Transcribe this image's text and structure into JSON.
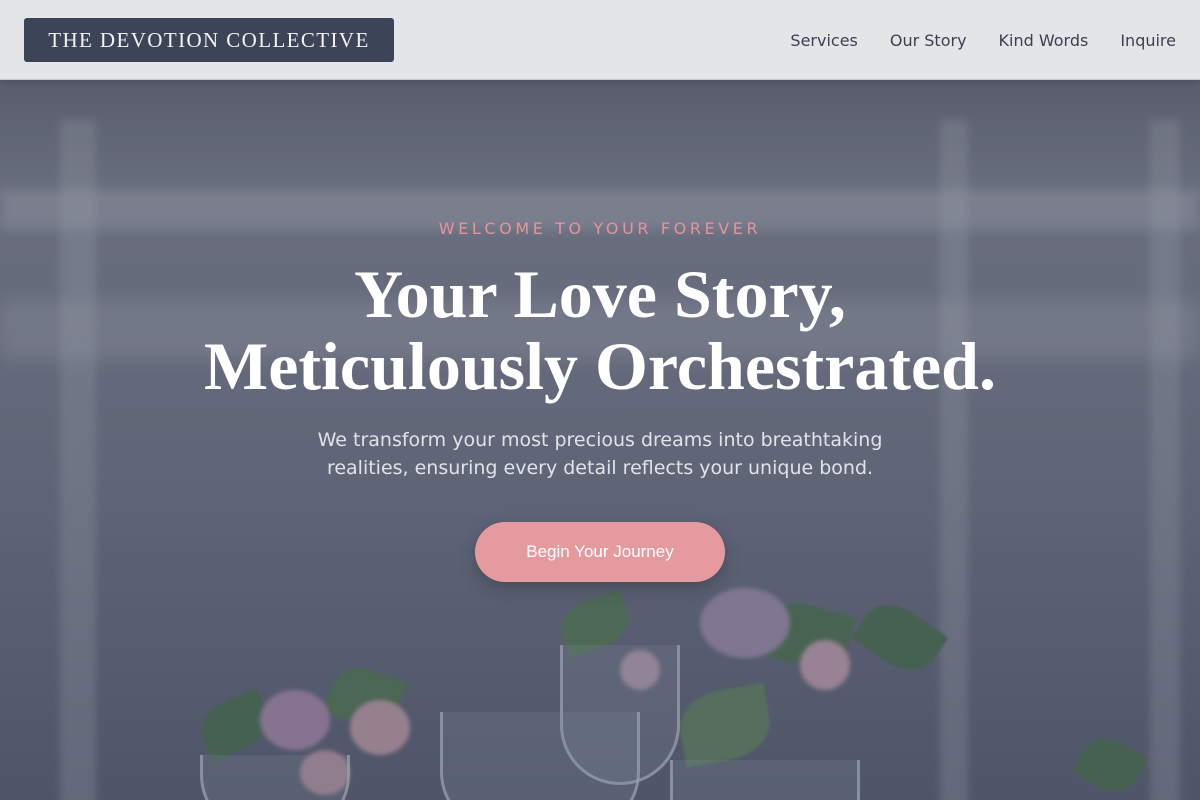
{
  "header": {
    "brand": "THE DEVOTION COLLECTIVE",
    "nav": [
      "Services",
      "Our Story",
      "Kind Words",
      "Inquire"
    ]
  },
  "hero": {
    "eyebrow": "WELCOME TO YOUR FOREVER",
    "headline_line1": "Your Love Story,",
    "headline_line2": "Meticulously Orchestrated.",
    "subtitle_line1": "We transform your most precious dreams into breathtaking",
    "subtitle_line2": "realities, ensuring every detail reflects your unique bond.",
    "cta_label": "Begin Your Journey"
  },
  "colors": {
    "brand_bg": "#3c4458",
    "header_bg": "#e4e5e7",
    "accent_pink": "#e59aa0",
    "eyebrow_pink": "#e7939a",
    "nav_text": "#3a4152"
  }
}
